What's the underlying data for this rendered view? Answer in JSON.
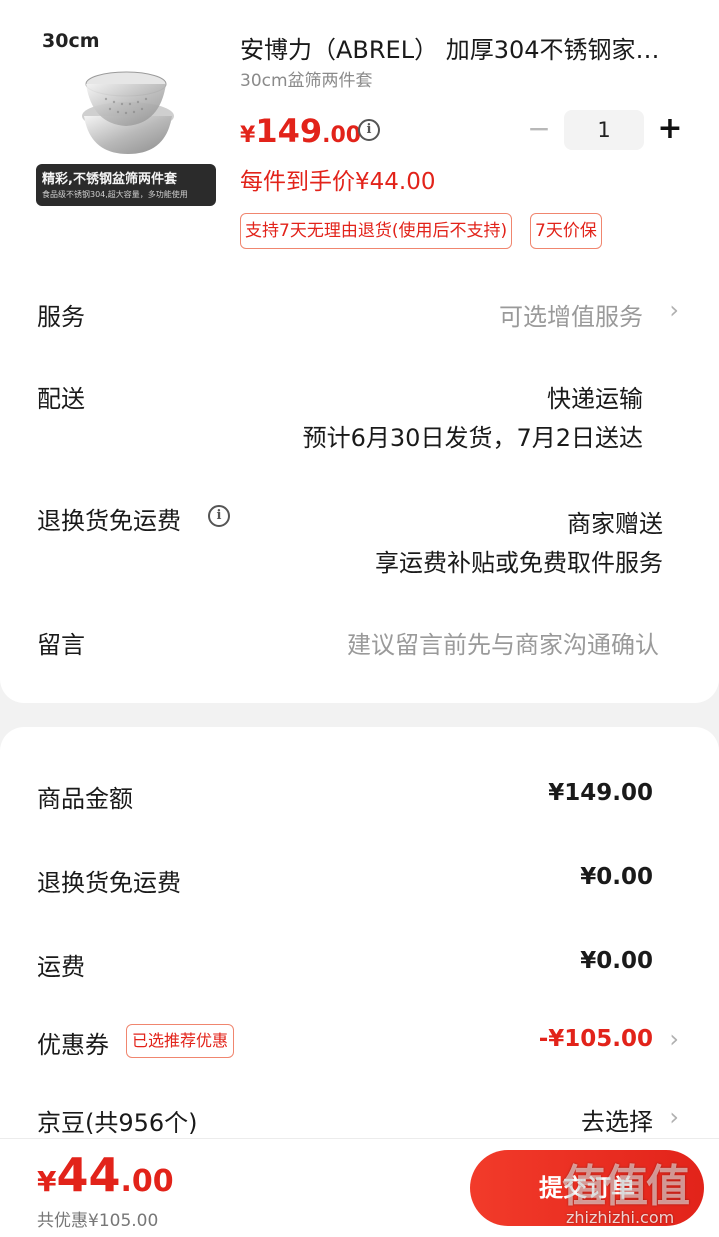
{
  "product": {
    "image_size_label": "30cm",
    "image_banner_main": "精彩,不锈钢盆筛两件套",
    "image_banner_sub": "食品级不锈钢304,超大容量，多功能使用",
    "title": "安博力（ABREL） 加厚304不锈钢家…",
    "subtitle": "30cm盆筛两件套",
    "price_yen": "¥",
    "price_int": "149",
    "price_dec": ".00",
    "quantity": "1",
    "unit_price": "每件到手价¥44.00",
    "tags": [
      "支持7天无理由退货(使用后不支持)",
      "7天价保"
    ]
  },
  "service": {
    "label": "服务",
    "value": "可选增值服务"
  },
  "delivery": {
    "label": "配送",
    "method": "快递运输",
    "estimate": "预计6月30日发货，7月2日送达"
  },
  "return_shipping": {
    "label": "退换货免运费",
    "value1": "商家赠送",
    "value2": "享运费补贴或免费取件服务"
  },
  "message": {
    "label": "留言",
    "placeholder": "建议留言前先与商家沟通确认"
  },
  "amounts": {
    "goods_label": "商品金额",
    "goods_value": "¥149.00",
    "return_label": "退换货免运费",
    "return_value": "¥0.00",
    "freight_label": "运费",
    "freight_value": "¥0.00",
    "coupon_label": "优惠券",
    "coupon_tag": "已选推荐优惠",
    "coupon_value": "-¥105.00",
    "jingdou_label": "京豆(共956个)",
    "jingdou_value": "去选择"
  },
  "footer": {
    "total_yen": "¥",
    "total_int": "44",
    "total_dec": ".00",
    "saved": "共优惠¥105.00",
    "submit": "提交订单"
  },
  "watermark": {
    "main": "值值值",
    "sub": "zhizhizhi.com"
  },
  "colors": {
    "accent": "#e2231a",
    "background": "#f2f2f2"
  }
}
